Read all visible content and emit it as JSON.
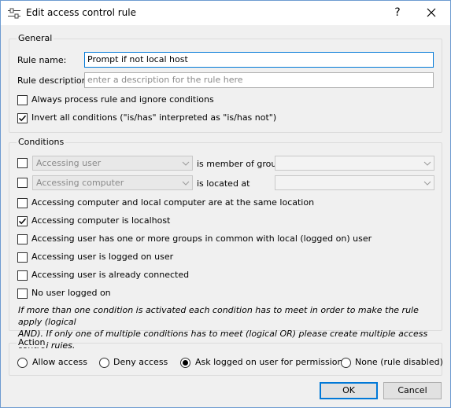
{
  "window": {
    "title": "Edit access control rule",
    "help_label": "?",
    "close_icon": "close-icon"
  },
  "general": {
    "group_label": "General",
    "rule_name_label": "Rule name:",
    "rule_name_value": "Prompt if not local host",
    "rule_description_label": "Rule description:",
    "rule_description_placeholder": "enter a description for the rule here",
    "always_process_label": "Always process rule and ignore conditions",
    "always_process_checked": false,
    "invert_label": "Invert all conditions (\"is/has\" interpreted as \"is/has not\")",
    "invert_checked": true
  },
  "conditions": {
    "group_label": "Conditions",
    "user_group": {
      "checked": false,
      "subject": "Accessing user",
      "relation": "is member of group",
      "value": ""
    },
    "computer_location": {
      "checked": false,
      "subject": "Accessing computer",
      "relation": "is located at",
      "value": ""
    },
    "items": [
      {
        "label": "Accessing computer and local computer are at the same location",
        "checked": false
      },
      {
        "label": "Accessing computer is localhost",
        "checked": true
      },
      {
        "label": "Accessing user has one or more groups in common with local (logged on) user",
        "checked": false
      },
      {
        "label": "Accessing user is logged on user",
        "checked": false
      },
      {
        "label": "Accessing user is already connected",
        "checked": false
      },
      {
        "label": "No user logged on",
        "checked": false
      }
    ],
    "note_line1": "If more than one condition is activated each condition has to meet in order to make the rule apply (logical",
    "note_line2": "AND). If only one of multiple conditions has to meet (logical OR) please create multiple access control rules."
  },
  "action": {
    "group_label": "Action",
    "options": [
      {
        "label": "Allow access",
        "selected": false
      },
      {
        "label": "Deny access",
        "selected": false
      },
      {
        "label": "Ask logged on user for permission",
        "selected": true
      },
      {
        "label": "None (rule disabled)",
        "selected": false
      }
    ]
  },
  "buttons": {
    "ok": "OK",
    "cancel": "Cancel"
  },
  "colors": {
    "accent": "#0078d7",
    "background": "#f0f0f0"
  }
}
